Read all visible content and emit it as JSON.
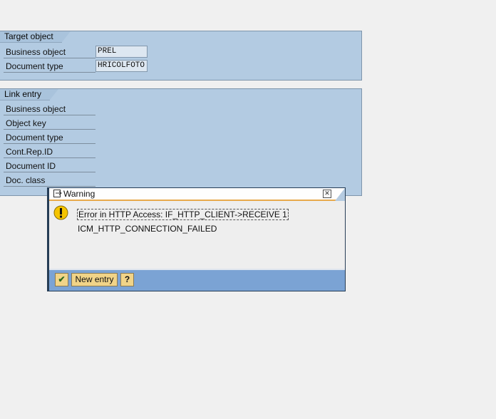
{
  "target_object": {
    "title": "Target object",
    "fields": [
      {
        "label": "Business object",
        "value": "PREL"
      },
      {
        "label": "Document type",
        "value": "HRICOLFOTO"
      }
    ]
  },
  "link_entry": {
    "title": "Link entry",
    "fields": [
      {
        "label": "Business object"
      },
      {
        "label": "Object key"
      },
      {
        "label": "Document type"
      },
      {
        "label": "Cont.Rep.ID"
      },
      {
        "label": "Document ID"
      },
      {
        "label": "Doc. class"
      }
    ]
  },
  "dialog": {
    "title": "Warning",
    "close_symbol": "✕",
    "icon": "warning-icon",
    "message_line1": "Error in HTTP Access: IF_HTTP_CLIENT->RECEIVE 1",
    "message_line2": "ICM_HTTP_CONNECTION_FAILED",
    "buttons": {
      "ok_symbol": "✔",
      "new_entry": "New entry",
      "help_symbol": "?"
    }
  }
}
